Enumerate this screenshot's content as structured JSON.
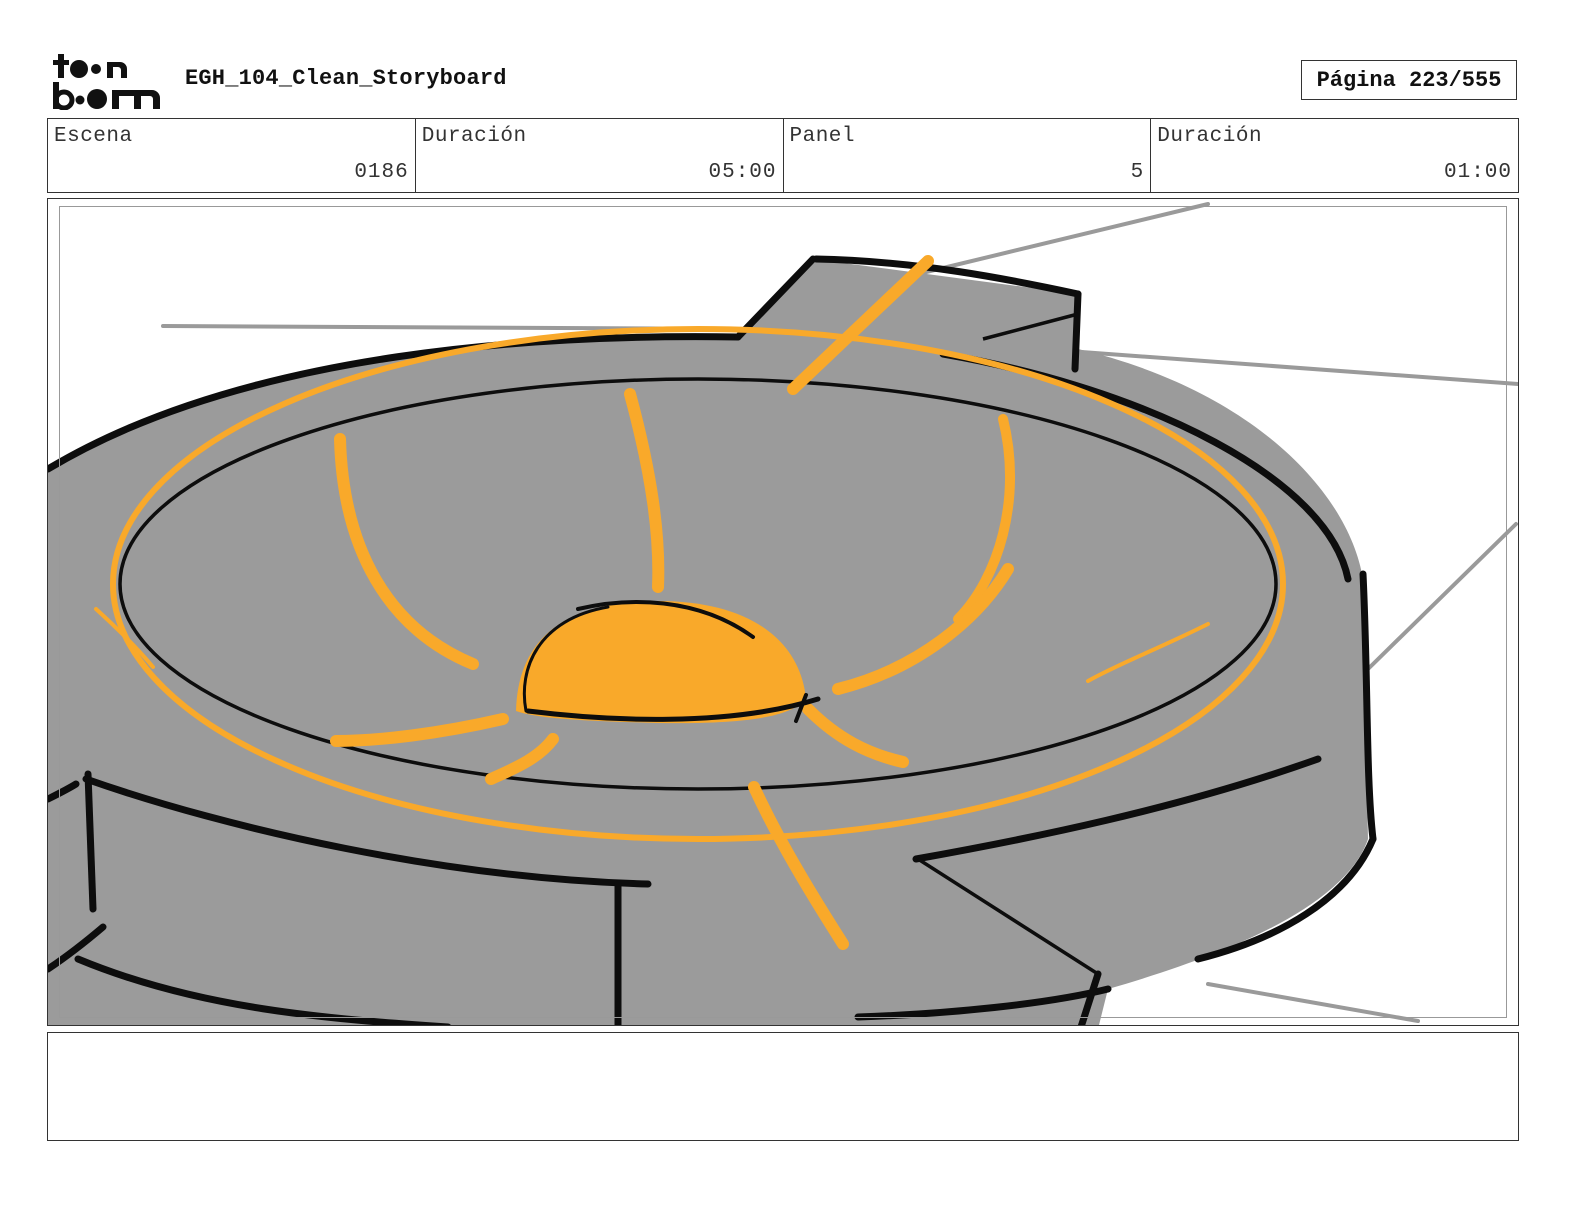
{
  "header": {
    "logo_text": "toon boom",
    "document_title": "EGH_104_Clean_Storyboard",
    "page_label": "Página",
    "page_number": "223/555"
  },
  "info": {
    "scene_label": "Escena",
    "scene_value": "0186",
    "scene_duration_label": "Duración",
    "scene_duration_value": "05:00",
    "panel_label": "Panel",
    "panel_value": "5",
    "panel_duration_label": "Duración",
    "panel_duration_value": "01:00"
  },
  "panel": {
    "drawing": "robot-vacuum-sketch-icon",
    "colors": {
      "body": "#9b9b9b",
      "highlight": "#f9a92a",
      "ink": "#0d0d0d",
      "background_lines": "#999999"
    }
  },
  "notes": {
    "text": ""
  }
}
